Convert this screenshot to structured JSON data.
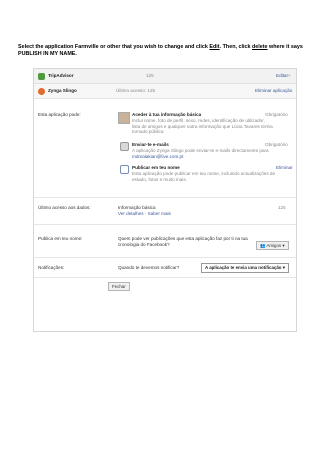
{
  "instruction": {
    "part1": "Select the application Farmville or other that you wish to change and click ",
    "edit_word": "Edit",
    "part2": ". Then, click ",
    "delete_word": "delete",
    "part3": " where it says PUBLISH IN MY NAME."
  },
  "header": {
    "app_name": "TripAdvisor",
    "count": "125",
    "edit_label": "Editar"
  },
  "app_row": {
    "app_name": "Zynga Slingo",
    "last_access": "Último acesso: 125",
    "remove_label": "Eliminar aplicação"
  },
  "permissions": {
    "section_label": "Esta aplicação pode:",
    "items": [
      {
        "title": "Aceder à tua informação básica",
        "desc": [
          "Inclui nome, foto de perfil, sexo, redes, identificação de utilizador,",
          "lista de amigos e qualquer outra informação que Lúcia Tavares tenha",
          "tornado pública"
        ],
        "status": "Obrigatório"
      },
      {
        "title": "Enviar-te e-mails",
        "desc": [
          "A aplicação Zynga Slingo pode enviar-te e-mails directamente para",
          "mdmalakian@live.com.pt"
        ],
        "status": "Obrigatório"
      },
      {
        "title": "Publicar em teu nome",
        "desc": [
          "Esta aplicação pode publicar em teu nome, incluindo actualizações de",
          "estado, fotos e muito mais."
        ],
        "status": "Eliminar"
      }
    ]
  },
  "last_data": {
    "label": "Último acesso aos dados:",
    "value": "Informação básica",
    "links": "Ver detalhes · Saber mais",
    "count": "125"
  },
  "publish": {
    "label": "Publica em teu nome:",
    "question": [
      "Quem pode ver publicações que esta aplicação faz por ti na tua",
      "cronologia do Facebook?"
    ],
    "audience": "Amigos"
  },
  "notifications": {
    "label": "Notificações:",
    "question": "Quando te devemos notificar?",
    "option": "A aplicação te envia uma notificação"
  },
  "close_label": "Fechar"
}
